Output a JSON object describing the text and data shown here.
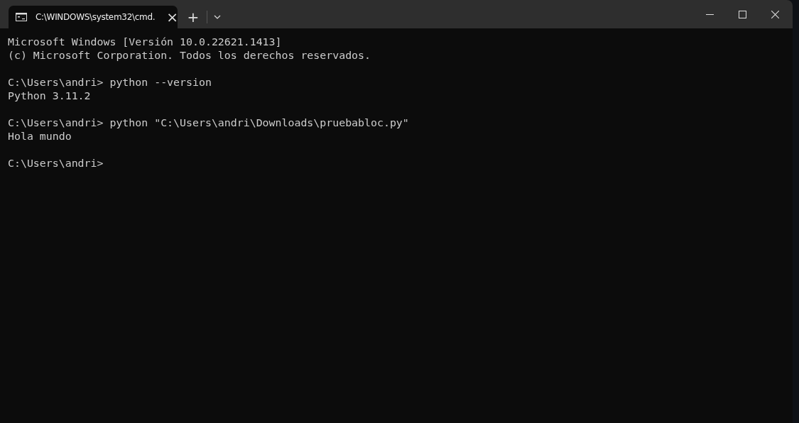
{
  "tab": {
    "title": "C:\\WINDOWS\\system32\\cmd.",
    "selected": true,
    "close": "×"
  },
  "new_tab": "+",
  "terminal": {
    "blocks": [
      [
        "Microsoft Windows [Versión 10.0.22621.1413]",
        "(c) Microsoft Corporation. Todos los derechos reservados."
      ],
      [
        "C:\\Users\\andri> python --version",
        "Python 3.11.2"
      ],
      [
        "C:\\Users\\andri> python \"C:\\Users\\andri\\Downloads\\pruebabloc.py\"",
        "Hola mundo"
      ],
      [
        "C:\\Users\\andri>"
      ]
    ]
  }
}
